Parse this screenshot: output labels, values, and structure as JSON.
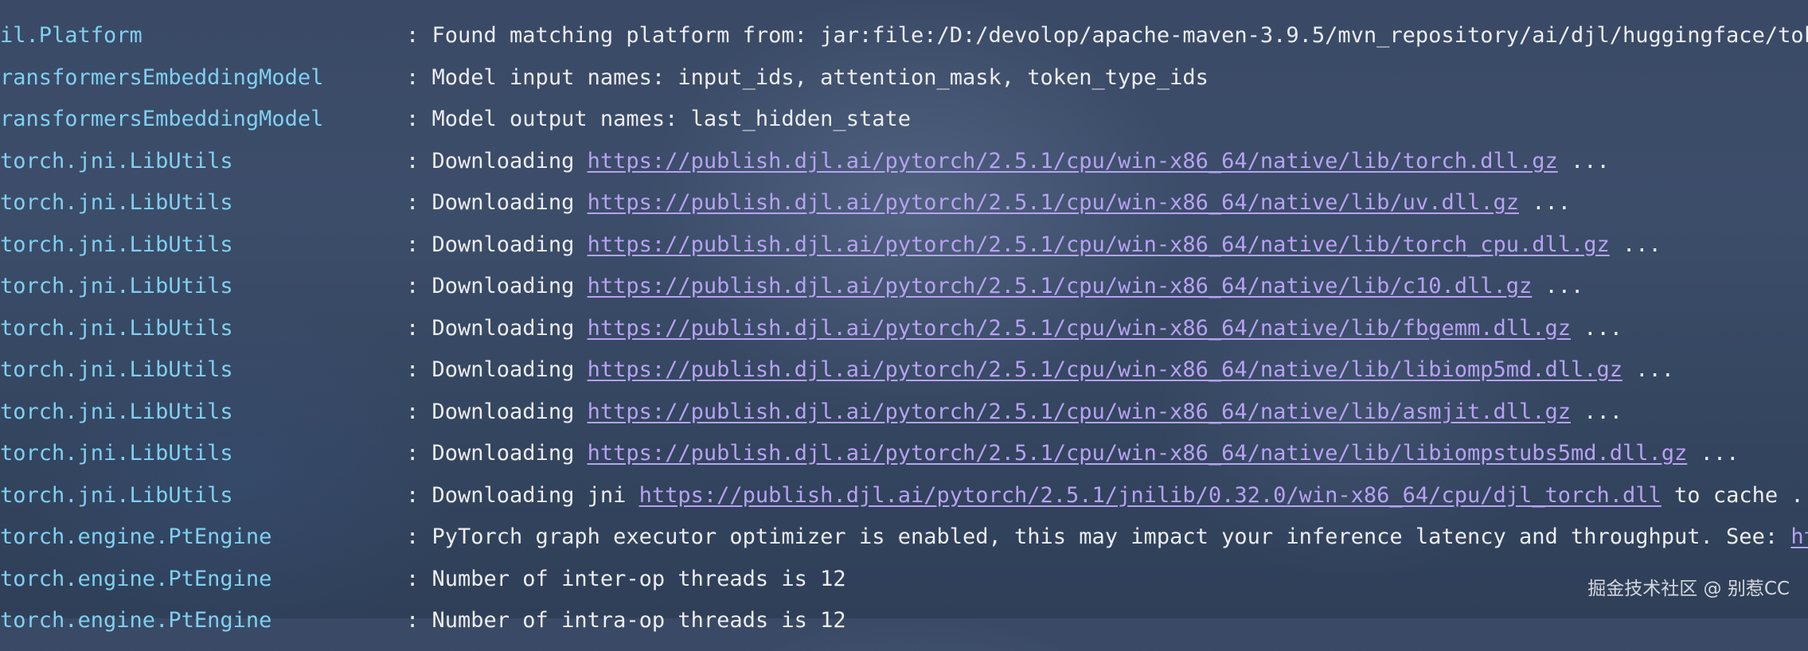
{
  "log_lines": [
    {
      "logger": "il.Platform",
      "sep": ": ",
      "text": "Found matching platform from: jar:file:/D:/devolop/apache-maven-3.9.5/mvn_repository/ai/djl/huggingface/toke",
      "link": "",
      "after": ""
    },
    {
      "logger": "ransformersEmbeddingModel",
      "sep": ": ",
      "text": "Model input names: input_ids, attention_mask, token_type_ids",
      "link": "",
      "after": ""
    },
    {
      "logger": "ransformersEmbeddingModel",
      "sep": ": ",
      "text": "Model output names: last_hidden_state",
      "link": "",
      "after": ""
    },
    {
      "logger": "torch.jni.LibUtils",
      "sep": ": ",
      "text": "Downloading ",
      "link": "https://publish.djl.ai/pytorch/2.5.1/cpu/win-x86_64/native/lib/torch.dll.gz",
      "after": " ..."
    },
    {
      "logger": "torch.jni.LibUtils",
      "sep": ": ",
      "text": "Downloading ",
      "link": "https://publish.djl.ai/pytorch/2.5.1/cpu/win-x86_64/native/lib/uv.dll.gz",
      "after": " ..."
    },
    {
      "logger": "torch.jni.LibUtils",
      "sep": ": ",
      "text": "Downloading ",
      "link": "https://publish.djl.ai/pytorch/2.5.1/cpu/win-x86_64/native/lib/torch_cpu.dll.gz",
      "after": " ..."
    },
    {
      "logger": "torch.jni.LibUtils",
      "sep": ": ",
      "text": "Downloading ",
      "link": "https://publish.djl.ai/pytorch/2.5.1/cpu/win-x86_64/native/lib/c10.dll.gz",
      "after": " ..."
    },
    {
      "logger": "torch.jni.LibUtils",
      "sep": ": ",
      "text": "Downloading ",
      "link": "https://publish.djl.ai/pytorch/2.5.1/cpu/win-x86_64/native/lib/fbgemm.dll.gz",
      "after": " ..."
    },
    {
      "logger": "torch.jni.LibUtils",
      "sep": ": ",
      "text": "Downloading ",
      "link": "https://publish.djl.ai/pytorch/2.5.1/cpu/win-x86_64/native/lib/libiomp5md.dll.gz",
      "after": " ..."
    },
    {
      "logger": "torch.jni.LibUtils",
      "sep": ": ",
      "text": "Downloading ",
      "link": "https://publish.djl.ai/pytorch/2.5.1/cpu/win-x86_64/native/lib/asmjit.dll.gz",
      "after": " ..."
    },
    {
      "logger": "torch.jni.LibUtils",
      "sep": ": ",
      "text": "Downloading ",
      "link": "https://publish.djl.ai/pytorch/2.5.1/cpu/win-x86_64/native/lib/libiompstubs5md.dll.gz",
      "after": " ..."
    },
    {
      "logger": "torch.jni.LibUtils",
      "sep": ": ",
      "text": "Downloading jni ",
      "link": "https://publish.djl.ai/pytorch/2.5.1/jnilib/0.32.0/win-x86_64/cpu/djl_torch.dll",
      "after": " to cache ..."
    },
    {
      "logger": "torch.engine.PtEngine",
      "sep": ": ",
      "text": "PyTorch graph executor optimizer is enabled, this may impact your inference latency and throughput. See: ",
      "link": "htt",
      "after": ""
    },
    {
      "logger": "torch.engine.PtEngine",
      "sep": ": ",
      "text": "Number of inter-op threads is 12",
      "link": "",
      "after": ""
    },
    {
      "logger": "torch.engine.PtEngine",
      "sep": ": ",
      "text": "Number of intra-op threads is 12",
      "link": "",
      "after": ""
    }
  ],
  "watermark": "掘金技术社区 @ 别惹CC",
  "colors": {
    "logger": "#7fd0f0",
    "message": "#ecedf2",
    "link": "#b7a2f2",
    "background": "#3a4a66"
  }
}
